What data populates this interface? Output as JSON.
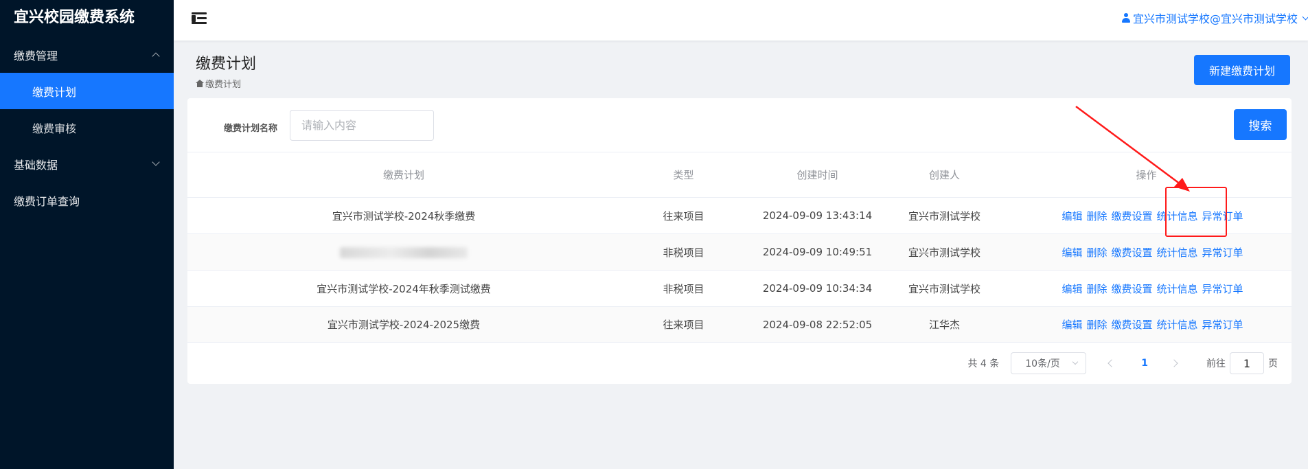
{
  "app": {
    "title": "宜兴校园缴费系统"
  },
  "sidebar": {
    "groups": [
      {
        "label": "缴费管理",
        "items": [
          {
            "label": "缴费计划"
          },
          {
            "label": "缴费审核"
          }
        ]
      },
      {
        "label": "基础数据"
      },
      {
        "label": "缴费订单查询"
      }
    ]
  },
  "header": {
    "user": "宜兴市测试学校@宜兴市测试学校"
  },
  "page": {
    "title": "缴费计划",
    "breadcrumb": "缴费计划",
    "new_button": "新建缴费计划"
  },
  "search": {
    "label": "缴费计划名称",
    "placeholder": "请输入内容",
    "button": "搜索"
  },
  "table": {
    "columns": [
      "缴费计划",
      "类型",
      "创建时间",
      "创建人",
      "操作"
    ],
    "actions": [
      "编辑",
      "删除",
      "缴费设置",
      "统计信息",
      "异常订单"
    ],
    "rows": [
      {
        "name": "宜兴市测试学校-2024秋季缴费",
        "type": "往来项目",
        "created": "2024-09-09 13:43:14",
        "creator": "宜兴市测试学校"
      },
      {
        "name": "",
        "type": "非税项目",
        "created": "2024-09-09 10:49:51",
        "creator": "宜兴市测试学校"
      },
      {
        "name": "宜兴市测试学校-2024年秋季测试缴费",
        "type": "非税项目",
        "created": "2024-09-09 10:34:34",
        "creator": "宜兴市测试学校"
      },
      {
        "name": "宜兴市测试学校-2024-2025缴费",
        "type": "往来项目",
        "created": "2024-09-08 22:52:05",
        "creator": "江华杰"
      }
    ]
  },
  "pagination": {
    "total": "共 4 条",
    "page_size": "10条/页",
    "current_page": "1",
    "goto_label": "前往",
    "goto_value": "1",
    "page_suffix": "页"
  },
  "annotation": {
    "color": "#ff1a1a"
  }
}
